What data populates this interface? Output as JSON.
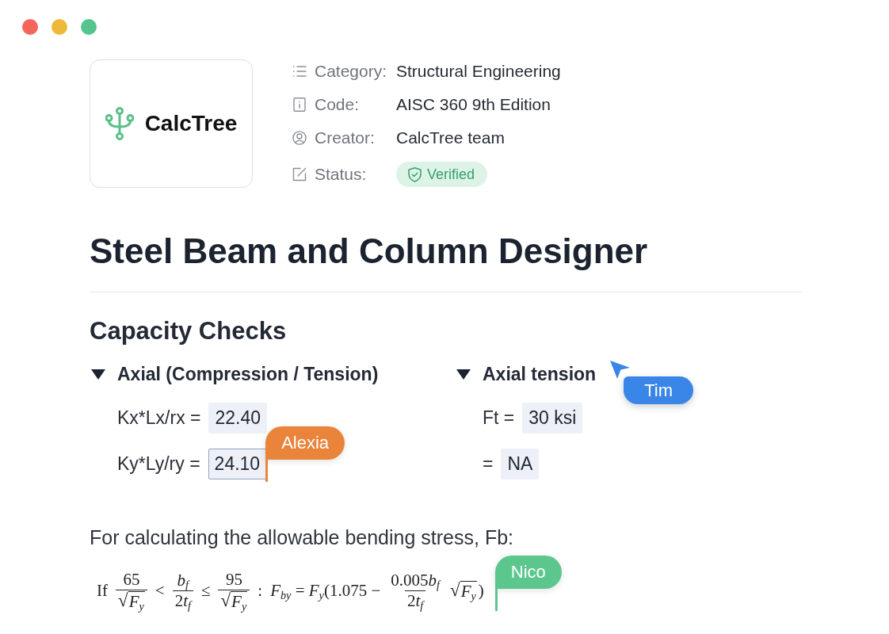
{
  "logo": {
    "text": "CalcTree"
  },
  "meta": [
    {
      "label": "Category:",
      "value": "Structural Engineering",
      "kind": "text"
    },
    {
      "label": "Code:",
      "value": "AISC 360 9th Edition",
      "kind": "text"
    },
    {
      "label": "Creator:",
      "value": "CalcTree team",
      "kind": "text"
    },
    {
      "label": "Status:",
      "value": "Verified",
      "kind": "badge"
    }
  ],
  "title": "Steel Beam and Column Designer",
  "section": {
    "title": "Capacity Checks",
    "groups": [
      {
        "title": "Axial (Compression / Tension)",
        "expanded": true,
        "rows": [
          {
            "label": "Kx*Lx/rx =",
            "value": "22.40",
            "focused": false
          },
          {
            "label": "Ky*Ly/ry =",
            "value": "24.10",
            "focused": true,
            "cursor": {
              "name": "Alexia",
              "kind": "caret",
              "color": "#e9843a"
            }
          }
        ]
      },
      {
        "title": "Axial tension",
        "expanded": true,
        "cursor": {
          "name": "Tim",
          "kind": "pointer",
          "color": "#3a86e8"
        },
        "rows": [
          {
            "label": "Ft =",
            "value": "30 ksi",
            "focused": false
          },
          {
            "label": "=",
            "value": "NA",
            "focused": false
          }
        ]
      }
    ]
  },
  "paragraph": "For calculating the allowable bending stress, Fb:",
  "formula": {
    "parts": [
      {
        "kind": "text",
        "text": "If"
      },
      {
        "kind": "frac",
        "num": {
          "texts": [
            "65"
          ]
        },
        "den": {
          "radical": "√",
          "texts": [
            "*F*$_{y}$"
          ]
        }
      },
      {
        "kind": "text",
        "text": "<"
      },
      {
        "kind": "frac",
        "num": {
          "texts": [
            "*b*$_{f}$"
          ]
        },
        "den": {
          "texts": [
            "2",
            "*t*$_{f}$"
          ]
        }
      },
      {
        "kind": "text",
        "text": "≤"
      },
      {
        "kind": "frac",
        "num": {
          "texts": [
            "95"
          ]
        },
        "den": {
          "radical": "√",
          "texts": [
            "*F*$_{y}$"
          ]
        }
      },
      {
        "kind": "text",
        "text": ":"
      },
      {
        "kind": "text",
        "text": "*F*$_{by}$ = *F*$_{y}$(1.075 −"
      },
      {
        "kind": "frac",
        "num": {
          "texts": [
            "0.005",
            "*b*$_{f}$"
          ]
        },
        "den": {
          "texts": [
            "2",
            "*t*$_{f}$"
          ]
        }
      },
      {
        "kind": "root",
        "radical": "√",
        "text": "*F*$_{y}$"
      },
      {
        "kind": "text",
        "text": ")"
      }
    ],
    "cursor": {
      "name": "Nico",
      "kind": "caret",
      "color": "#5cc78d"
    }
  }
}
